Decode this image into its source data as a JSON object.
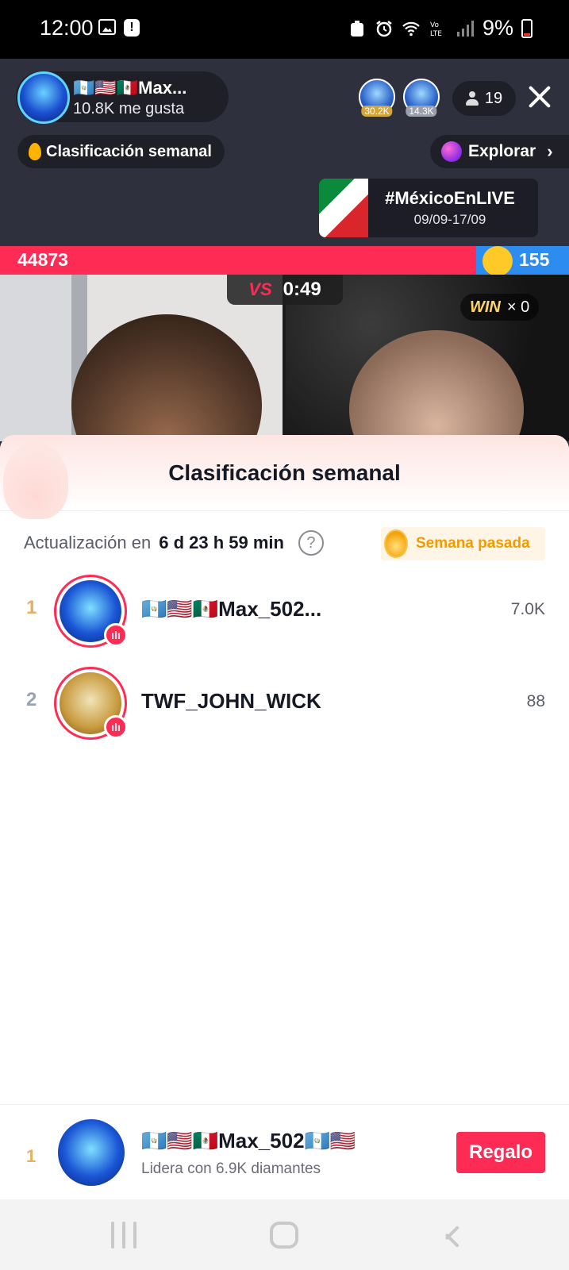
{
  "status_bar": {
    "time": "12:00",
    "battery": "9%",
    "icons": [
      "image-icon",
      "alert-icon",
      "recycle-icon",
      "alarm-icon",
      "wifi-icon",
      "volte-icon",
      "signal-icon",
      "battery-icon"
    ]
  },
  "live": {
    "host_name": "🇬🇹🇺🇸🇲🇽Max...",
    "host_likes": "10.8K me gusta",
    "top_viewers": [
      {
        "badge": "30.2K"
      },
      {
        "badge": "14.3K"
      }
    ],
    "viewer_count": "19",
    "weekly_ranking_pill": "Clasificación semanal",
    "explore_label": "Explorar",
    "promo_title": "#MéxicoEnLIVE",
    "promo_dates": "09/09-17/09"
  },
  "battle": {
    "score_left": "44873",
    "score_right": "155",
    "timer": "0:49",
    "vs_label": "VS",
    "win_label": "WIN",
    "win_count": "× 0"
  },
  "sheet": {
    "title": "Clasificación semanal",
    "update_label": "Actualización en",
    "update_value": "6 d 23 h 59 min",
    "help_symbol": "?",
    "last_week_label": "Semana pasada",
    "rows": [
      {
        "rank": "1",
        "name": "🇬🇹🇺🇸🇲🇽Max_502...",
        "score": "7.0K"
      },
      {
        "rank": "2",
        "name": "TWF_JOHN_WICK",
        "score": "88"
      }
    ]
  },
  "footer": {
    "rank": "1",
    "name": "🇬🇹🇺🇸🇲🇽Max_502🇬🇹🇺🇸",
    "subtitle": "Lidera con 6.9K diamantes",
    "gift_label": "Regalo"
  },
  "colors": {
    "accent": "#fe2c55",
    "blue_team": "#2d8cf0",
    "gold": "#f29b00"
  }
}
